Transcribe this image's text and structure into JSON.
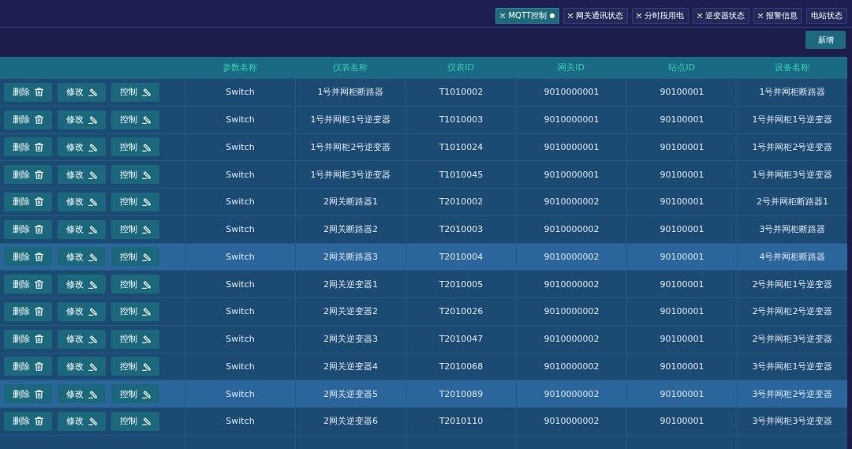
{
  "tabs": [
    {
      "label": "MQTT控制",
      "closable": true,
      "selected": true
    },
    {
      "label": "网关通讯状态",
      "closable": true,
      "selected": false
    },
    {
      "label": "分时段用电",
      "closable": true,
      "selected": false
    },
    {
      "label": "逆变器状态",
      "closable": true,
      "selected": false
    },
    {
      "label": "报警信息",
      "closable": true,
      "selected": false
    },
    {
      "label": "电站状态",
      "closable": false,
      "selected": false
    }
  ],
  "toolbar": {
    "add_button": "新增"
  },
  "table": {
    "columns": [
      "参数名称",
      "仪表名称",
      "仪表ID",
      "网关ID",
      "站点ID",
      "设备名称"
    ],
    "rows": [
      {
        "actions": [
          {
            "label": "删除",
            "kind": "delete"
          },
          {
            "label": "修改",
            "kind": "edit"
          },
          {
            "label": "控制",
            "kind": "control"
          }
        ],
        "cells": [
          "Switch",
          "1号并网柜断路器",
          "T1010002",
          "9010000001",
          "90100001",
          "1号并网柜断路器"
        ],
        "highlighted": false
      },
      {
        "actions": [
          {
            "label": "删除",
            "kind": "delete"
          },
          {
            "label": "修改",
            "kind": "edit"
          },
          {
            "label": "控制",
            "kind": "control"
          }
        ],
        "cells": [
          "Switch",
          "1号并网柜1号逆变器",
          "T1010003",
          "9010000001",
          "90100001",
          "1号并网柜1号逆变器"
        ],
        "highlighted": false
      },
      {
        "actions": [
          {
            "label": "删除",
            "kind": "delete"
          },
          {
            "label": "修改",
            "kind": "edit"
          },
          {
            "label": "控制",
            "kind": "control"
          }
        ],
        "cells": [
          "Switch",
          "1号并网柜2号逆变器",
          "T1010024",
          "9010000001",
          "90100001",
          "1号并网柜2号逆变器"
        ],
        "highlighted": false
      },
      {
        "actions": [
          {
            "label": "删除",
            "kind": "delete"
          },
          {
            "label": "修改",
            "kind": "edit"
          },
          {
            "label": "控制",
            "kind": "control"
          }
        ],
        "cells": [
          "Switch",
          "1号并网柜3号逆变器",
          "T1010045",
          "9010000001",
          "90100001",
          "1号并网柜3号逆变器"
        ],
        "highlighted": false
      },
      {
        "actions": [
          {
            "label": "删除",
            "kind": "delete"
          },
          {
            "label": "修改",
            "kind": "edit"
          },
          {
            "label": "控制",
            "kind": "control"
          }
        ],
        "cells": [
          "Switch",
          "2网关断路器1",
          "T2010002",
          "9010000002",
          "90100001",
          "2号并网柜断路器1"
        ],
        "highlighted": false
      },
      {
        "actions": [
          {
            "label": "删除",
            "kind": "delete"
          },
          {
            "label": "修改",
            "kind": "edit"
          },
          {
            "label": "控制",
            "kind": "control"
          }
        ],
        "cells": [
          "Switch",
          "2网关断路器2",
          "T2010003",
          "9010000002",
          "90100001",
          "3号并网柜断路器"
        ],
        "highlighted": false
      },
      {
        "actions": [
          {
            "label": "删除",
            "kind": "delete"
          },
          {
            "label": "修改",
            "kind": "edit"
          },
          {
            "label": "控制",
            "kind": "control"
          }
        ],
        "cells": [
          "Switch",
          "2网关断路器3",
          "T2010004",
          "9010000002",
          "90100001",
          "4号并网柜断路器"
        ],
        "highlighted": true
      },
      {
        "actions": [
          {
            "label": "删除",
            "kind": "delete"
          },
          {
            "label": "修改",
            "kind": "edit"
          },
          {
            "label": "控制",
            "kind": "control"
          }
        ],
        "cells": [
          "Switch",
          "2网关逆变器1",
          "T2010005",
          "9010000002",
          "90100001",
          "2号并网柜1号逆变器"
        ],
        "highlighted": false
      },
      {
        "actions": [
          {
            "label": "删除",
            "kind": "delete"
          },
          {
            "label": "修改",
            "kind": "edit"
          },
          {
            "label": "控制",
            "kind": "control"
          }
        ],
        "cells": [
          "Switch",
          "2网关逆变器2",
          "T2010026",
          "9010000002",
          "90100001",
          "2号并网柜2号逆变器"
        ],
        "highlighted": false
      },
      {
        "actions": [
          {
            "label": "删除",
            "kind": "delete"
          },
          {
            "label": "修改",
            "kind": "edit"
          },
          {
            "label": "控制",
            "kind": "control"
          }
        ],
        "cells": [
          "Switch",
          "2网关逆变器3",
          "T2010047",
          "9010000002",
          "90100001",
          "2号并网柜3号逆变器"
        ],
        "highlighted": false
      },
      {
        "actions": [
          {
            "label": "删除",
            "kind": "delete"
          },
          {
            "label": "修改",
            "kind": "edit"
          },
          {
            "label": "控制",
            "kind": "control"
          }
        ],
        "cells": [
          "Switch",
          "2网关逆变器4",
          "T2010068",
          "9010000002",
          "90100001",
          "3号并网柜1号逆变器"
        ],
        "highlighted": false
      },
      {
        "actions": [
          {
            "label": "删除",
            "kind": "delete"
          },
          {
            "label": "修改",
            "kind": "edit"
          },
          {
            "label": "控制",
            "kind": "control"
          }
        ],
        "cells": [
          "Switch",
          "2网关逆变器5",
          "T2010089",
          "9010000002",
          "90100001",
          "3号并网柜2号逆变器"
        ],
        "highlighted": true
      },
      {
        "actions": [
          {
            "label": "删除",
            "kind": "delete"
          },
          {
            "label": "修改",
            "kind": "edit"
          },
          {
            "label": "控制",
            "kind": "control"
          }
        ],
        "cells": [
          "Switch",
          "2网关逆变器6",
          "T2010110",
          "9010000002",
          "90100001",
          "3号并网柜3号逆变器"
        ],
        "highlighted": false
      }
    ]
  }
}
